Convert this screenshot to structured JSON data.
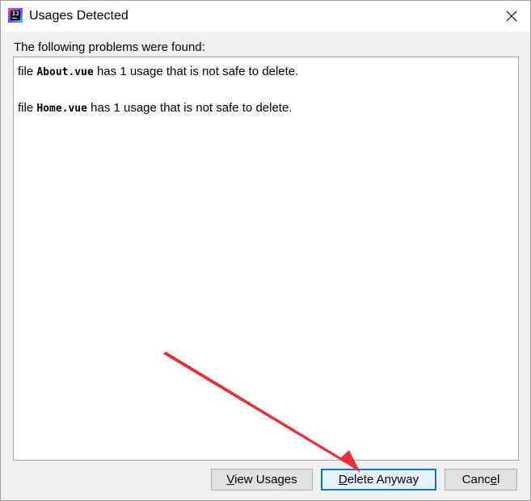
{
  "window": {
    "title": "Usages Detected",
    "icon": "intellij-app-icon",
    "close_icon": "close-icon"
  },
  "main": {
    "label": "The following problems were found:",
    "problems": [
      {
        "prefix": "file ",
        "filename": "About.vue",
        "suffix": " has 1 usage that is not safe to delete."
      },
      {
        "prefix": "file ",
        "filename": "Home.vue",
        "suffix": " has 1 usage that is not safe to delete."
      }
    ]
  },
  "buttons": {
    "view_usages": {
      "mnemonic": "V",
      "rest": "iew Usages"
    },
    "delete_anyway": {
      "mnemonic": "D",
      "rest": "elete Anyway"
    },
    "cancel": {
      "pre": "Canc",
      "mnemonic": "e",
      "rest": "l"
    }
  },
  "colors": {
    "annotation_arrow": "#e8303a",
    "default_button_border": "#0078d7"
  }
}
